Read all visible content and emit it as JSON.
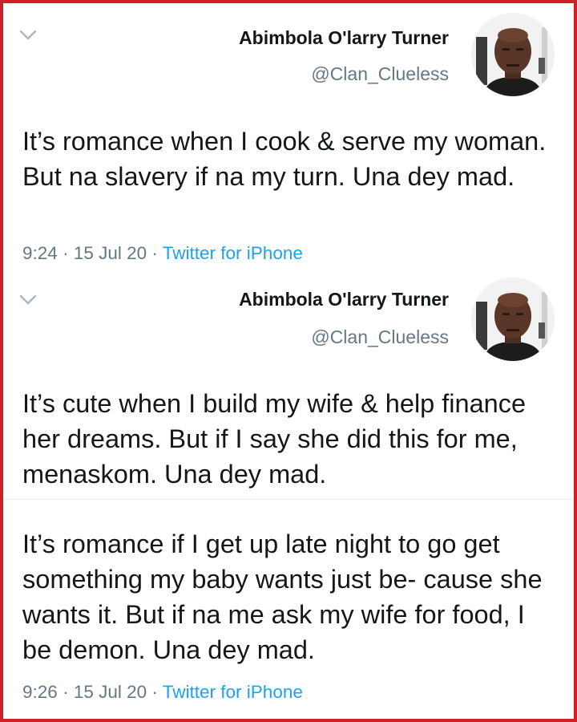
{
  "tweets": [
    {
      "author": {
        "name": "Abimbola O'larry Turner",
        "handle": "@Clan_Clueless"
      },
      "text": "It’s romance when I cook & serve my woman. But na slavery if na my turn. Una dey mad.",
      "time": "9:24",
      "date": "15 Jul 20",
      "source": "Twitter for iPhone",
      "separator": "·"
    },
    {
      "author": {
        "name": "Abimbola O'larry Turner",
        "handle": "@Clan_Clueless"
      },
      "text": "It’s cute when I build my wife & help finance her dreams. But if I say she did this for me, menaskom. Una dey mad."
    },
    {
      "text": "It’s romance if I get up late night to go get something my baby wants just be- cause she wants it. But if na me ask my wife for food, I be demon. Una dey mad.",
      "time": "9:26",
      "date": "15 Jul 20",
      "source": "Twitter for iPhone",
      "separator": "·"
    }
  ],
  "icons": {
    "menu": "chevron-down-icon",
    "avatar": "avatar"
  },
  "colors": {
    "frame_border": "#d02027",
    "text": "#14171a",
    "muted": "#657786",
    "link": "#1da1f2",
    "divider": "#e6ecf0"
  }
}
